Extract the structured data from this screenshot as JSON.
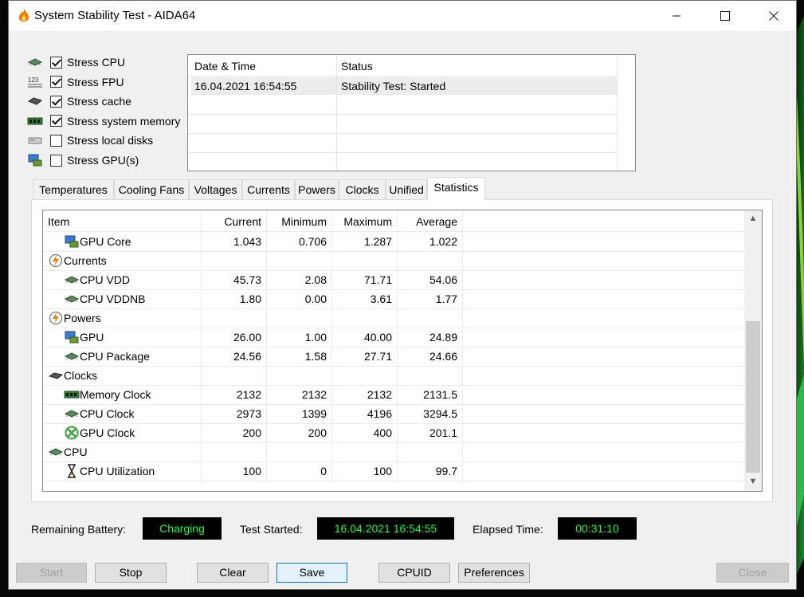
{
  "window": {
    "title": "System Stability Test - AIDA64"
  },
  "stress_options": [
    {
      "label": "Stress CPU",
      "checked": true,
      "icon": "cpu-chip-icon"
    },
    {
      "label": "Stress FPU",
      "checked": true,
      "icon": "fpu-123-icon"
    },
    {
      "label": "Stress cache",
      "checked": true,
      "icon": "cache-chip-icon"
    },
    {
      "label": "Stress system memory",
      "checked": true,
      "icon": "memory-module-icon"
    },
    {
      "label": "Stress local disks",
      "checked": false,
      "icon": "disk-icon"
    },
    {
      "label": "Stress GPU(s)",
      "checked": false,
      "icon": "gpu-icon"
    }
  ],
  "log": {
    "columns": [
      "Date & Time",
      "Status"
    ],
    "rows": [
      {
        "datetime": "16.04.2021 16:54:55",
        "status": "Stability Test: Started"
      }
    ]
  },
  "tabs": [
    "Temperatures",
    "Cooling Fans",
    "Voltages",
    "Currents",
    "Powers",
    "Clocks",
    "Unified",
    "Statistics"
  ],
  "active_tab": "Statistics",
  "stats": {
    "columns": [
      "Item",
      "Current",
      "Minimum",
      "Maximum",
      "Average"
    ],
    "rows": [
      {
        "item": "GPU Core",
        "level": 1,
        "icon": "gpu-icon",
        "current": "1.043",
        "minimum": "0.706",
        "maximum": "1.287",
        "average": "1.022"
      },
      {
        "item": "Currents",
        "level": 0,
        "icon": "lightning-icon",
        "current": "",
        "minimum": "",
        "maximum": "",
        "average": ""
      },
      {
        "item": "CPU VDD",
        "level": 1,
        "icon": "cpu-chip-icon",
        "current": "45.73",
        "minimum": "2.08",
        "maximum": "71.71",
        "average": "54.06"
      },
      {
        "item": "CPU VDDNB",
        "level": 1,
        "icon": "cpu-chip-icon",
        "current": "1.80",
        "minimum": "0.00",
        "maximum": "3.61",
        "average": "1.77"
      },
      {
        "item": "Powers",
        "level": 0,
        "icon": "lightning-icon",
        "current": "",
        "minimum": "",
        "maximum": "",
        "average": ""
      },
      {
        "item": "GPU",
        "level": 1,
        "icon": "gpu-icon",
        "current": "26.00",
        "minimum": "1.00",
        "maximum": "40.00",
        "average": "24.89"
      },
      {
        "item": "CPU Package",
        "level": 1,
        "icon": "cpu-chip-icon",
        "current": "24.56",
        "minimum": "1.58",
        "maximum": "27.71",
        "average": "24.66"
      },
      {
        "item": "Clocks",
        "level": 0,
        "icon": "clock-chip-icon",
        "current": "",
        "minimum": "",
        "maximum": "",
        "average": ""
      },
      {
        "item": "Memory Clock",
        "level": 1,
        "icon": "memory-module-icon",
        "current": "2132",
        "minimum": "2132",
        "maximum": "2132",
        "average": "2131.5"
      },
      {
        "item": "CPU Clock",
        "level": 1,
        "icon": "cpu-chip-icon",
        "current": "2973",
        "minimum": "1399",
        "maximum": "4196",
        "average": "3294.5"
      },
      {
        "item": "GPU Clock",
        "level": 1,
        "icon": "xbox-icon",
        "current": "200",
        "minimum": "200",
        "maximum": "400",
        "average": "201.1"
      },
      {
        "item": "CPU",
        "level": 0,
        "icon": "cpu-chip-icon",
        "current": "",
        "minimum": "",
        "maximum": "",
        "average": ""
      },
      {
        "item": "CPU Utilization",
        "level": 1,
        "icon": "hourglass-icon",
        "current": "100",
        "minimum": "0",
        "maximum": "100",
        "average": "99.7"
      }
    ]
  },
  "status": {
    "battery_label": "Remaining Battery:",
    "battery_value": "Charging",
    "started_label": "Test Started:",
    "started_value": "16.04.2021 16:54:55",
    "elapsed_label": "Elapsed Time:",
    "elapsed_value": "00:31:10"
  },
  "buttons": {
    "start": "Start",
    "stop": "Stop",
    "clear": "Clear",
    "save": "Save",
    "cpuid": "CPUID",
    "preferences": "Preferences",
    "close": "Close"
  },
  "colors": {
    "digital_text": "#14ff3c",
    "digital_bg": "#000000",
    "accent": "#0078d7"
  }
}
